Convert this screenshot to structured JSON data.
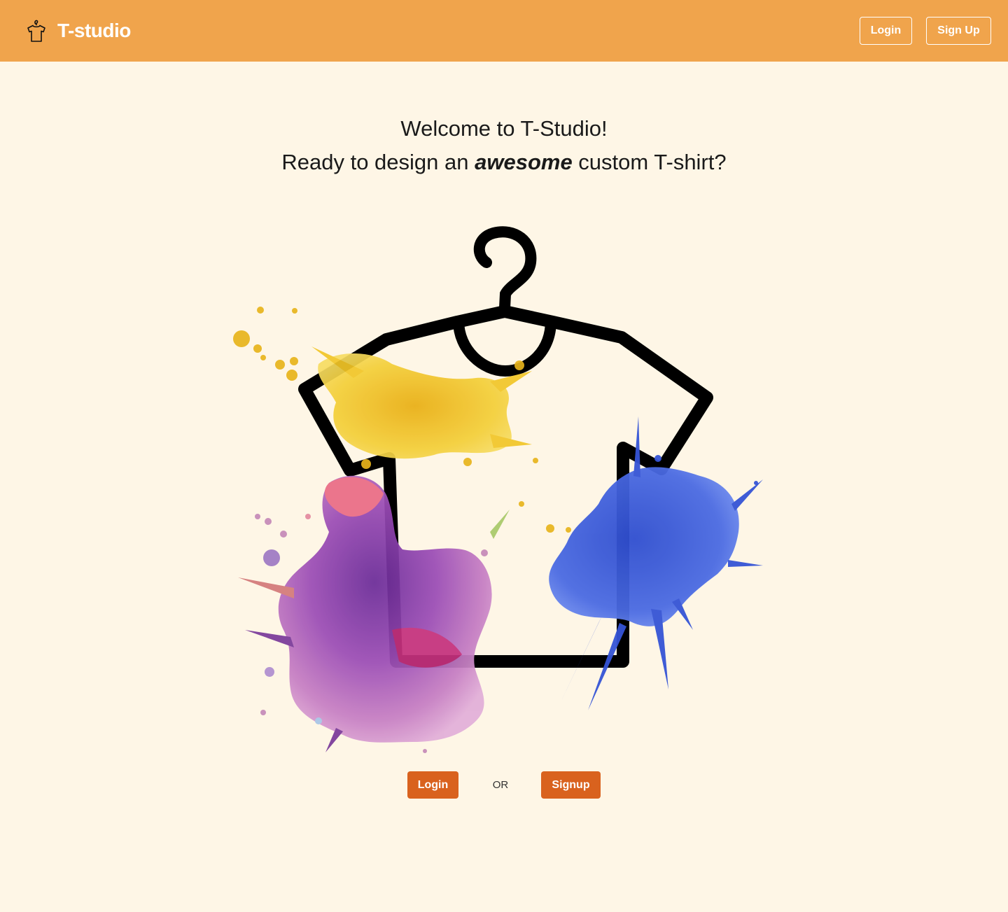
{
  "header": {
    "brand": "T-studio",
    "brand_icon": "tshirt-hanger-icon",
    "login_label": "Login",
    "signup_label": "Sign Up"
  },
  "hero": {
    "line1": "Welcome to T-Studio!",
    "line2_prefix": "Ready to design an ",
    "line2_emphasis": "awesome",
    "line2_suffix": " custom T-shirt?",
    "illustration_icon": "tshirt-on-hanger-paint-splash-icon"
  },
  "cta": {
    "login_label": "Login",
    "or_text": "OR",
    "signup_label": "Signup"
  },
  "colors": {
    "header_bg": "#f0a44c",
    "page_bg": "#fef6e6",
    "cta_bg": "#d9621e",
    "splash_yellow": "#f2c21f",
    "splash_blue": "#3b5bd6",
    "splash_purple": "#8a3ea6",
    "splash_pink": "#e2659b"
  }
}
